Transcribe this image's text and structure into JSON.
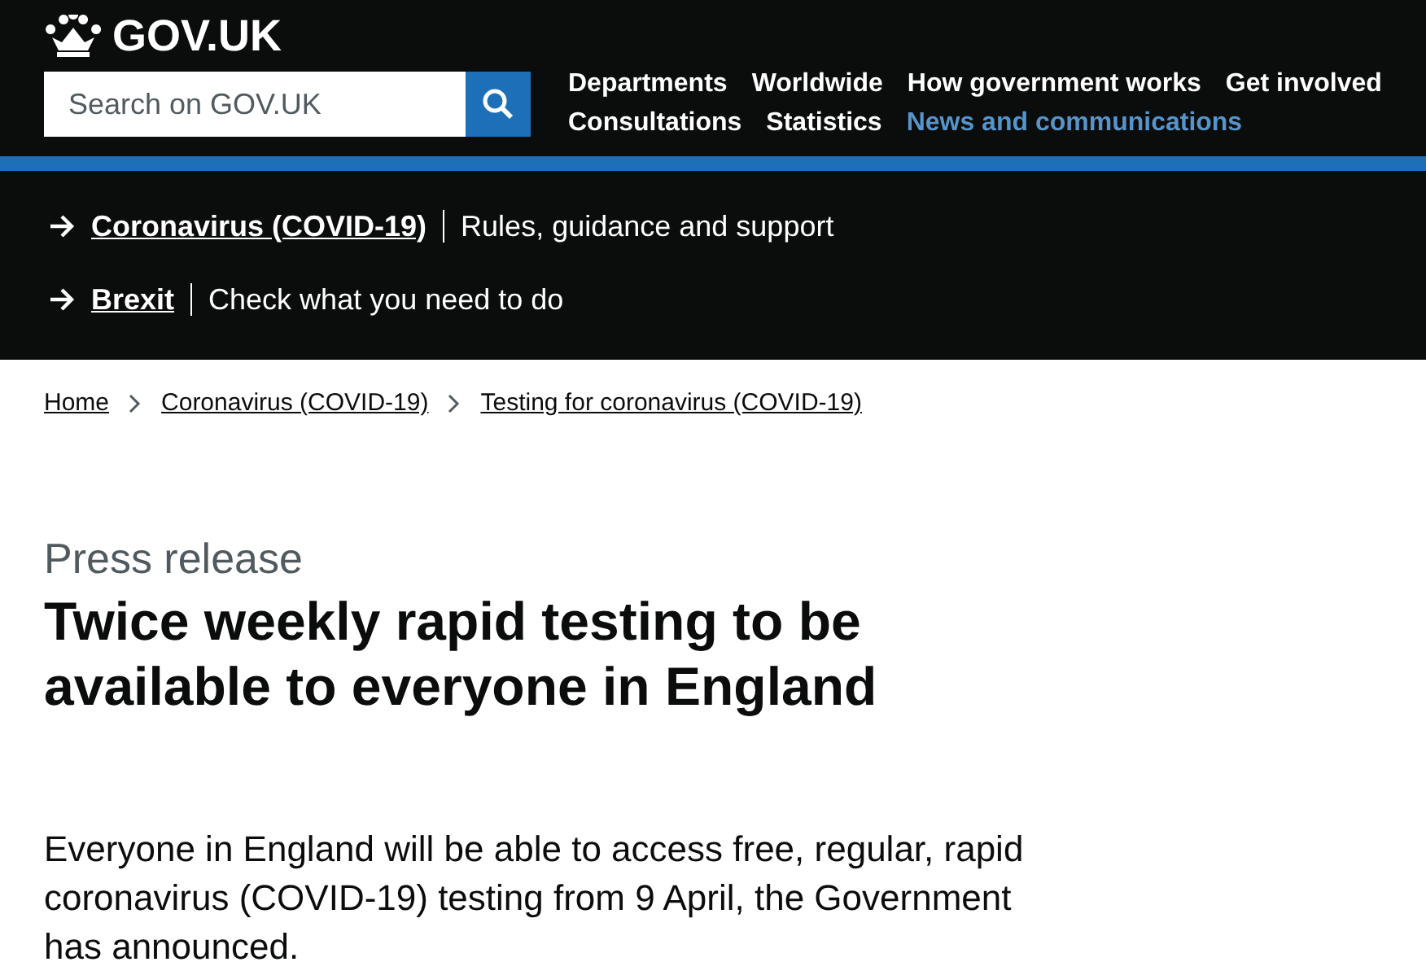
{
  "header": {
    "logo": "GOV.UK",
    "search": {
      "placeholder": "Search on GOV.UK"
    },
    "nav": [
      {
        "label": "Departments",
        "selected": false
      },
      {
        "label": "Worldwide",
        "selected": false
      },
      {
        "label": "How government works",
        "selected": false
      },
      {
        "label": "Get involved",
        "selected": false
      },
      {
        "label": "Consultations",
        "selected": false
      },
      {
        "label": "Statistics",
        "selected": false
      },
      {
        "label": "News and communications",
        "selected": true
      }
    ]
  },
  "promo_links": [
    {
      "link": "Coronavirus (COVID-19)",
      "description": "Rules, guidance and support"
    },
    {
      "link": "Brexit",
      "description": "Check what you need to do"
    }
  ],
  "breadcrumbs": [
    "Home",
    "Coronavirus (COVID-19)",
    "Testing for coronavirus (COVID-19)"
  ],
  "article": {
    "type": "Press release",
    "title": "Twice weekly rapid testing to be available to everyone in England",
    "lead": "Everyone in England will be able to access free, regular, rapid coronavirus (COVID-19) testing from 9 April, the Government has announced."
  }
}
